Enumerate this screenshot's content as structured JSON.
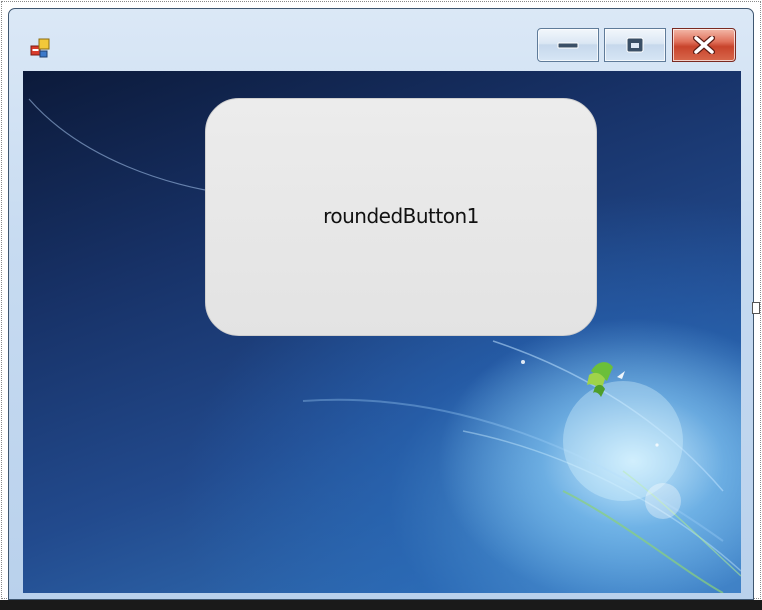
{
  "window": {
    "title": "",
    "caption_buttons": {
      "minimize": "minimize-icon",
      "maximize": "restore-icon",
      "close": "close-icon"
    },
    "icon": "app-form-icon"
  },
  "client": {
    "background": "windows-7-wallpaper",
    "rounded_button": {
      "label": "roundedButton1"
    }
  },
  "colors": {
    "frame": "#c7dbf1",
    "close_button": "#d0503a",
    "button_face": "#e6e6e6",
    "wallpaper_dark": "#0c1a3a",
    "wallpaper_light": "#a9d8f3"
  }
}
